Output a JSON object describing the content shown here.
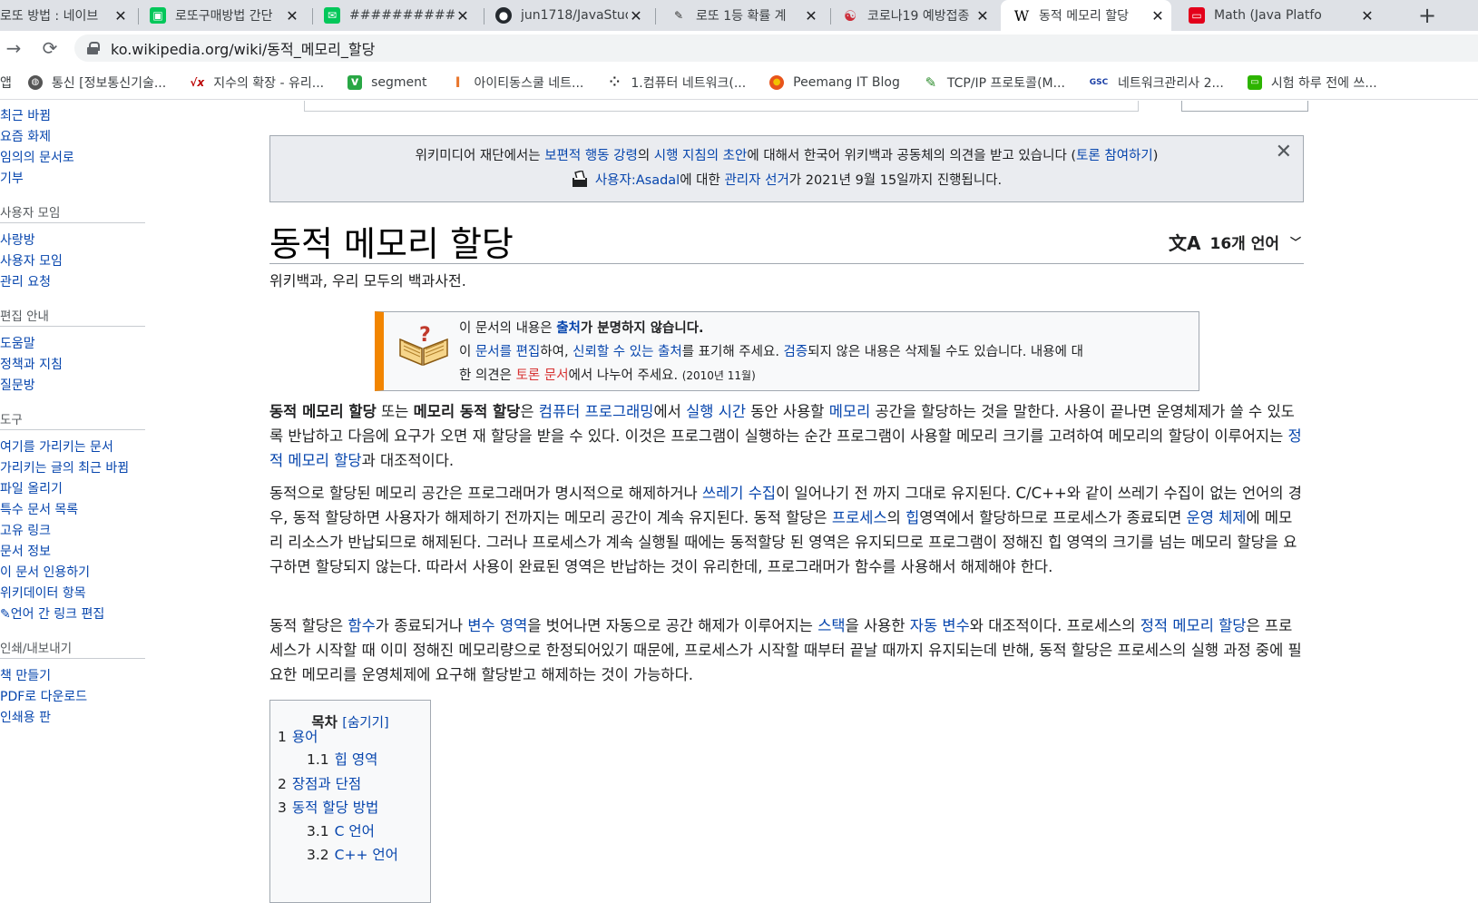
{
  "tabs": [
    {
      "title": "로또 방법 : 네이브",
      "fav_color": "#ffffff",
      "fav_text": ""
    },
    {
      "title": "로또구매방법 간단",
      "fav_color": "#03c75a",
      "fav_text": "▣"
    },
    {
      "title": "##############",
      "fav_color": "#03c75a",
      "fav_text": "✉"
    },
    {
      "title": "jun1718/JavaStud",
      "fav_color": "#24292e",
      "fav_text": "●"
    },
    {
      "title": "로또 1등 확률 계",
      "fav_color": "#ffffff",
      "fav_text": "✎"
    },
    {
      "title": "코로나19 예방접종",
      "fav_color": "#ffffff",
      "fav_text": "☯"
    },
    {
      "title": "동적 메모리 할당",
      "fav_color": "#ffffff",
      "fav_text": "W"
    },
    {
      "title": "Math (Java Platfo",
      "fav_color": "#e3001b",
      "fav_text": "▭"
    }
  ],
  "toolbar": {
    "url": "ko.wikipedia.org/wiki/동적_메모리_할당",
    "new_tab": "+",
    "back": "→",
    "reload": "⟳"
  },
  "bookmarks": [
    {
      "label": "앱",
      "color": ""
    },
    {
      "label": "통신 [정보통신기술...",
      "color": "#555555",
      "icon": "◍"
    },
    {
      "label": "지수의 확장 - 유리...",
      "color": "#ffffff",
      "icon": "√x"
    },
    {
      "label": "segment",
      "color": "#29a745",
      "icon": "v"
    },
    {
      "label": "아이티동스쿨 네트...",
      "color": "#ffffff",
      "icon": "Ⅰ"
    },
    {
      "label": "1.컴퓨터 네트워크(...",
      "color": "#ffffff",
      "icon": "⁘"
    },
    {
      "label": "Peemang IT Blog",
      "color": "#f2a900",
      "icon": "●"
    },
    {
      "label": "TCP/IP 프로토콜(M...",
      "color": "#ffffff",
      "icon": "✎"
    },
    {
      "label": "네트워크관리사 2...",
      "color": "#ffffff",
      "icon": "GSC"
    },
    {
      "label": "시험 하루 전에 쓰...",
      "color": "#2db400",
      "icon": "▭"
    }
  ],
  "sidebar": {
    "groups": [
      {
        "heading": "",
        "items": [
          "최근 바뀜",
          "요즘 화제",
          "임의의 문서로",
          "기부"
        ]
      },
      {
        "heading": "사용자 모임",
        "items": [
          "사랑방",
          "사용자 모임",
          "관리 요청"
        ]
      },
      {
        "heading": "편집 안내",
        "items": [
          "도움말",
          "정책과 지침",
          "질문방"
        ]
      },
      {
        "heading": "도구",
        "items": [
          "여기를 가리키는 문서",
          "가리키는 글의 최근 바뀜",
          "파일 올리기",
          "특수 문서 목록",
          "고유 링크",
          "문서 정보",
          "이 문서 인용하기",
          "위키데이터 항목",
          "✎언어 간 링크 편집"
        ]
      },
      {
        "heading": "인쇄/내보내기",
        "items": [
          "책 만들기",
          "PDF로 다운로드",
          "인쇄용 판"
        ]
      }
    ]
  },
  "notice": {
    "l1_a": "위키미디어 재단에서는 ",
    "l1_link1": "보편적 행동 강령",
    "l1_b": "의 ",
    "l1_link2": "시행 지침의 초안",
    "l1_c": "에 대해서 한국어 위키백과 공동체의 의견을 받고 있습니다 (",
    "l1_link3": "토론 참여하기",
    "l1_d": ")",
    "l2_link1": "사용자:Asadal",
    "l2_a": "에 대한 ",
    "l2_link2": "관리자 선거",
    "l2_b": "가 2021년 9월 15일까지 진행됩니다.",
    "close": "✕"
  },
  "page": {
    "title": "동적 메모리 할당",
    "languages": "16개 언어",
    "tagline": "위키백과, 우리 모두의 백과사전."
  },
  "ambox": {
    "l1_a": "이 문서의 내용은 ",
    "l1_link": "출처",
    "l1_b": "가 분명하지 않습니다.",
    "l2_a": "이 ",
    "l2_link1": "문서를 편집",
    "l2_b": "하여, ",
    "l2_link2": "신뢰할 수 있는 출처",
    "l2_c": "를 표기해 주세요. ",
    "l2_link3": "검증",
    "l2_d": "되지 않은 내용은 삭제될 수도 있습니다. 내용에 대",
    "l3_a": "한 의견은 ",
    "l3_link": "토론 문서",
    "l3_b": "에서 나누어 주세요. ",
    "l3_date": "(2010년 11월)"
  },
  "p1": {
    "b1": "동적 메모리 할당",
    "t1": " 또는 ",
    "b2": "메모리 동적 할당",
    "t2": "은 ",
    "a1": "컴퓨터 프로그래밍",
    "t3": "에서 ",
    "a2": "실행 시간",
    "t4": " 동안 사용할 ",
    "a3": "메모리",
    "t5": " 공간을 할당하는 것을 말한다. 사용이 끝나면 운영체제가 쓸 수 있도록 반납하고 다음에 요구가 오면 재 할당을 받을 수 있다. 이것은 프로그램이 실행하는 순간 프로그램이 사용할 메모리 크기를 고려하여 메모리의 할당이 이루어지는 ",
    "a4": "정적 메모리 할당",
    "t6": "과 대조적이다."
  },
  "p2": {
    "t1": "동적으로 할당된 메모리 공간은 프로그래머가 명시적으로 해제하거나 ",
    "a1": "쓰레기 수집",
    "t2": "이 일어나기 전 까지 그대로 유지된다. C/C++와 같이 쓰레기 수집이 없는 언어의 경우, 동적 할당하면 사용자가 해제하기 전까지는 메모리 공간이 계속 유지된다. 동적 할당은 ",
    "a2": "프로세스",
    "t3": "의 ",
    "a3": "힙",
    "t4": "영역에서 할당하므로 프로세스가 종료되면 ",
    "a4": "운영 체제",
    "t5": "에 메모리 리소스가 반납되므로 해제된다. 그러나 프로세스가 계속 실행될 때에는 동적할당 된 영역은 유지되므로 프로그램이 정해진 힙 영역의 크기를 넘는 메모리 할당을 요구하면 할당되지 않는다. 따라서 사용이 완료된 영역은 반납하는 것이 유리한데, 프로그래머가 함수를 사용해서 해제해야 한다."
  },
  "p3": {
    "t1": "동적 할당은 ",
    "a1": "함수",
    "t2": "가 종료되거나 ",
    "a2": "변수 영역",
    "t3": "을 벗어나면 자동으로 공간 해제가 이루어지는 ",
    "a3": "스택",
    "t4": "을 사용한 ",
    "a4": "자동 변수",
    "t5": "와 대조적이다. 프로세스의 ",
    "a5": "정적 메모리 할당",
    "t6": "은 프로세스가 시작할 때 이미 정해진 메모리량으로 한정되어있기 때문에, 프로세스가 시작할 때부터 끝날 때까지 유지되는데 반해, 동적 할당은 프로세스의 실행 과정 중에 필요한 메모리를 운영체제에 요구해 할당받고 해제하는 것이 가능하다."
  },
  "toc": {
    "title": "목차",
    "hide": "[숨기기]",
    "items": [
      {
        "num": "1",
        "label": "용어"
      },
      {
        "num": "1.1",
        "label": "힙 영역"
      },
      {
        "num": "2",
        "label": "장점과 단점"
      },
      {
        "num": "3",
        "label": "동적 할당 방법"
      },
      {
        "num": "3.1",
        "label": "C 언어"
      },
      {
        "num": "3.2",
        "label": "C++ 언어"
      }
    ]
  }
}
